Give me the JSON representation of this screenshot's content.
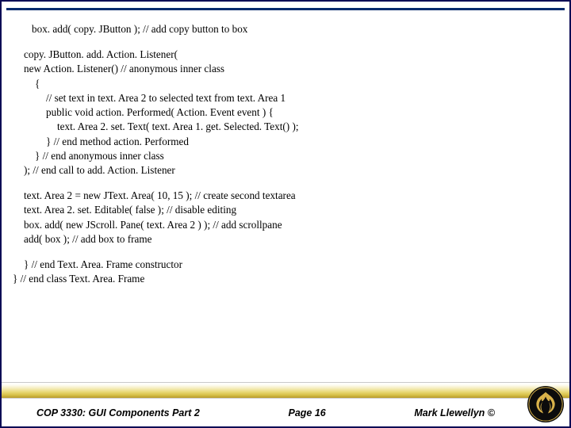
{
  "code": {
    "blk1": {
      "l1": "box. add( copy. JButton ); // add copy button to box"
    },
    "blk2": {
      "l1": "copy. JButton. add. Action. Listener(",
      "l2": "new Action. Listener() // anonymous inner class",
      "l3": "{",
      "l4": "// set text in text. Area 2 to selected text from text. Area 1",
      "l5": "public void action. Performed( Action. Event event )  {",
      "l6": "text. Area 2. set. Text( text. Area 1. get. Selected. Text() );",
      "l7": "} // end method action. Performed",
      "l8": "} // end anonymous inner class",
      "l9": "); // end call to add. Action. Listener"
    },
    "blk3": {
      "l1": "text. Area 2 = new JText. Area( 10, 15 ); // create second textarea",
      "l2": "text. Area 2. set. Editable( false ); // disable editing",
      "l3": "box. add( new JScroll. Pane( text. Area 2 ) ); // add scrollpane",
      "l4": "add( box ); // add box to frame"
    },
    "blk4": {
      "l1": "} // end Text. Area. Frame constructor",
      "l2": "} // end class Text. Area. Frame"
    }
  },
  "footer": {
    "left": "COP 3330: GUI Components Part 2",
    "center": "Page 16",
    "right": "Mark Llewellyn ©"
  },
  "seal": {
    "name": "ucf-pegasus-seal",
    "bg": "#0c0c0c",
    "fg": "#d9b24a"
  }
}
